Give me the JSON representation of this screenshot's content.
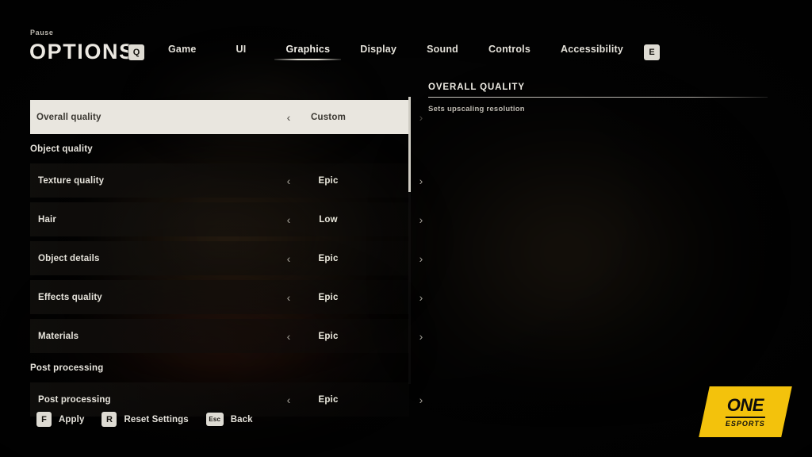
{
  "header": {
    "breadcrumb": "Pause",
    "title": "OPTIONS",
    "prev_tab_key": "Q",
    "next_tab_key": "E"
  },
  "tabs": [
    {
      "label": "Game",
      "active": false
    },
    {
      "label": "UI",
      "active": false
    },
    {
      "label": "Graphics",
      "active": true
    },
    {
      "label": "Display",
      "active": false
    },
    {
      "label": "Sound",
      "active": false
    },
    {
      "label": "Controls",
      "active": false
    },
    {
      "label": "Accessibility",
      "active": false
    }
  ],
  "settings": {
    "selected_row": "Overall quality",
    "rows": [
      {
        "type": "setting",
        "label": "Overall quality",
        "value": "Custom",
        "selected": true
      },
      {
        "type": "section",
        "label": "Object quality"
      },
      {
        "type": "setting",
        "label": "Texture quality",
        "value": "Epic",
        "selected": false
      },
      {
        "type": "setting",
        "label": "Hair",
        "value": "Low",
        "selected": false
      },
      {
        "type": "setting",
        "label": "Object details",
        "value": "Epic",
        "selected": false
      },
      {
        "type": "setting",
        "label": "Effects quality",
        "value": "Epic",
        "selected": false
      },
      {
        "type": "setting",
        "label": "Materials",
        "value": "Epic",
        "selected": false
      },
      {
        "type": "section",
        "label": "Post processing"
      },
      {
        "type": "setting",
        "label": "Post processing",
        "value": "Epic",
        "selected": false
      }
    ],
    "chevron_left": "‹",
    "chevron_right": "›"
  },
  "info_panel": {
    "title": "OVERALL QUALITY",
    "description": "Sets upscaling resolution"
  },
  "actions": [
    {
      "key": "F",
      "label": "Apply"
    },
    {
      "key": "R",
      "label": "Reset Settings"
    },
    {
      "key": "Esc",
      "label": "Back"
    }
  ],
  "watermark": {
    "line1": "ONE",
    "line2": "ESPORTS",
    "color": "#f3c20c"
  }
}
